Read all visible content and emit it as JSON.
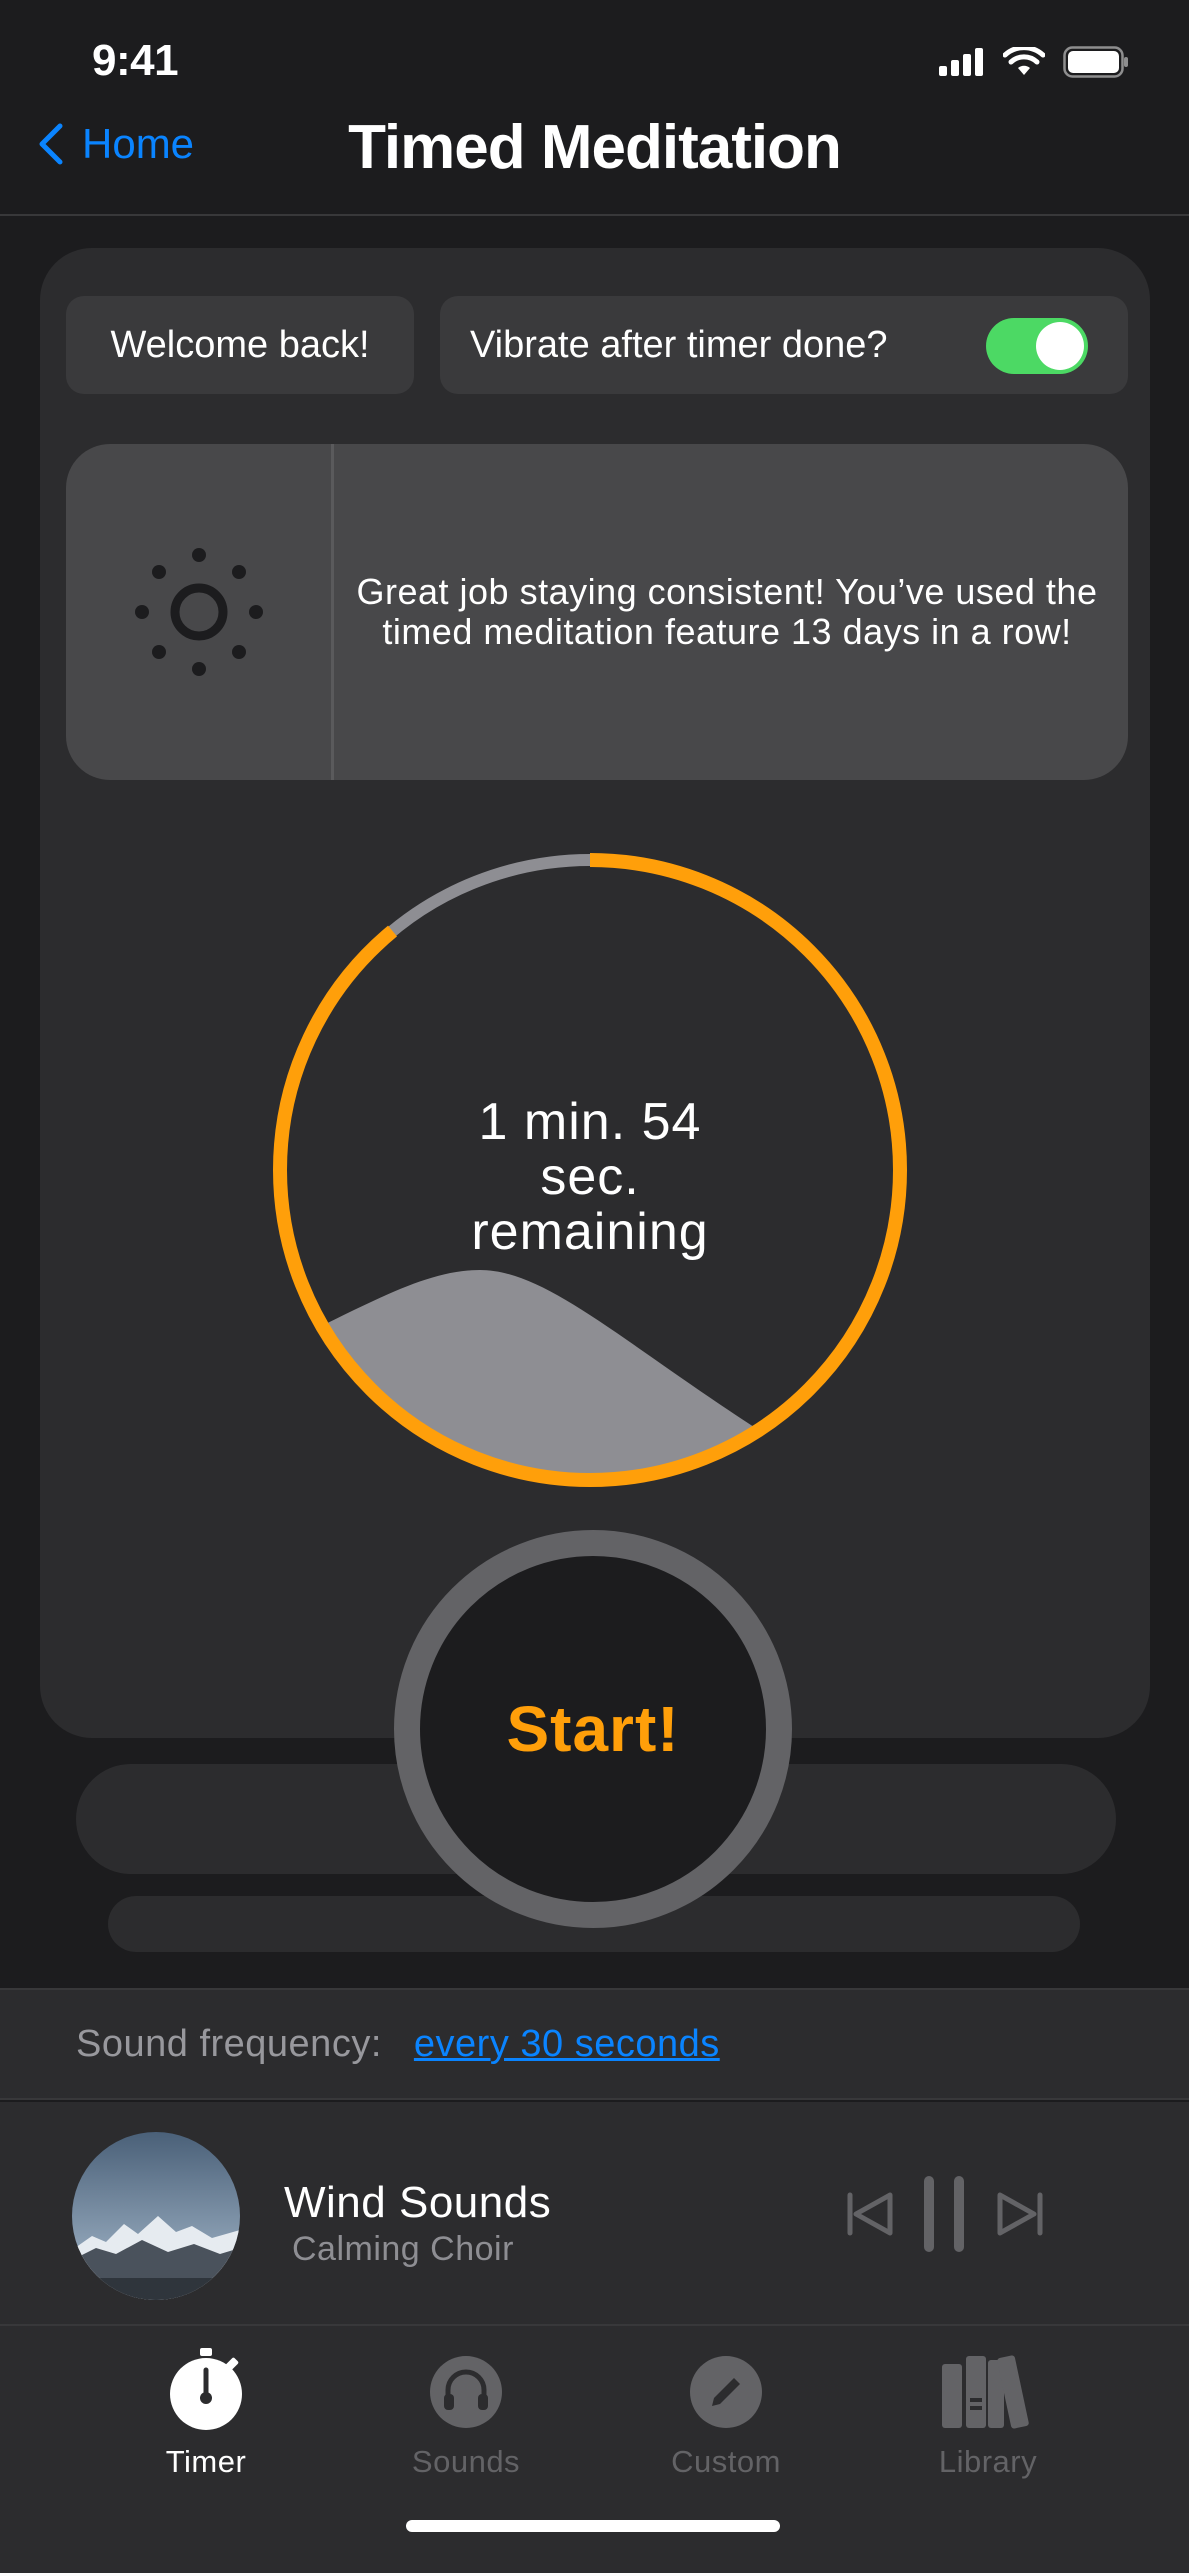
{
  "status_bar": {
    "time": "9:41"
  },
  "nav": {
    "back_label": "Home",
    "title": "Timed Meditation"
  },
  "welcome": {
    "text": "Welcome back!"
  },
  "vibrate": {
    "label": "Vibrate after timer done?",
    "enabled": true
  },
  "streak": {
    "message": "Great job staying consistent! You’ve used the timed meditation feature 13 days in a row!"
  },
  "timer": {
    "line1": "1 min. 54",
    "line2": "sec.",
    "line3": "remaining",
    "progress_fraction": 0.89,
    "colors": {
      "progress": "#ff9f0a",
      "track": "#8e8e93",
      "wave": "#8e8e93"
    }
  },
  "start_button": {
    "label": "Start!"
  },
  "sound_frequency": {
    "label": "Sound frequency:",
    "value": "every 30 seconds"
  },
  "now_playing": {
    "title": "Wind Sounds",
    "artist": "Calming Choir",
    "state": "playing"
  },
  "tabs": [
    {
      "label": "Timer",
      "icon": "stopwatch-icon",
      "active": true
    },
    {
      "label": "Sounds",
      "icon": "headphones-icon",
      "active": false
    },
    {
      "label": "Custom",
      "icon": "pencil-icon",
      "active": false
    },
    {
      "label": "Library",
      "icon": "books-icon",
      "active": false
    }
  ],
  "colors": {
    "accent": "#0a84ff",
    "orange": "#ff9f0a",
    "toggle_on": "#4cd964",
    "background": "#1c1c1e",
    "card": "#2c2c2e"
  }
}
